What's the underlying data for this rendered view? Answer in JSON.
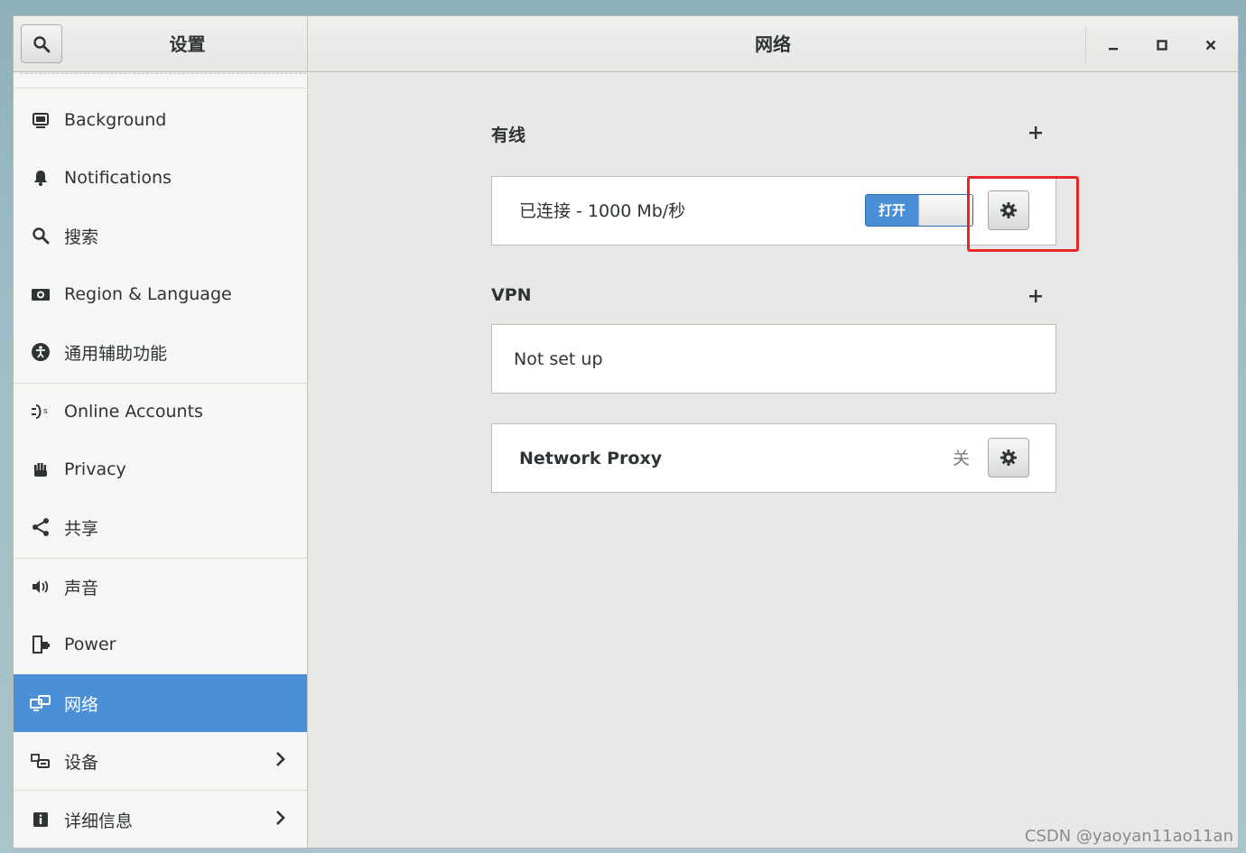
{
  "header": {
    "left_title": "设置",
    "title": "网络"
  },
  "window_controls": {
    "minimize": "minimize-icon",
    "maximize": "maximize-icon",
    "close": "close-icon"
  },
  "sidebar": {
    "items": [
      {
        "label": "Background",
        "icon": "background-icon"
      },
      {
        "label": "Notifications",
        "icon": "bell-icon"
      },
      {
        "label": "搜索",
        "icon": "search-icon"
      },
      {
        "label": "Region & Language",
        "icon": "camera-icon"
      },
      {
        "label": "通用辅助功能",
        "icon": "accessibility-icon"
      },
      {
        "label": "Online Accounts",
        "icon": "online-accounts-icon"
      },
      {
        "label": "Privacy",
        "icon": "hand-icon"
      },
      {
        "label": "共享",
        "icon": "share-icon"
      },
      {
        "label": "声音",
        "icon": "speaker-icon"
      },
      {
        "label": "Power",
        "icon": "power-icon"
      },
      {
        "label": "网络",
        "icon": "network-icon",
        "active": true
      },
      {
        "label": "设备",
        "icon": "devices-icon",
        "chevron": true
      },
      {
        "label": "详细信息",
        "icon": "info-icon",
        "chevron": true
      }
    ]
  },
  "wired": {
    "label": "有线",
    "status": "已连接 - 1000 Mb/秒",
    "switch_label": "打开"
  },
  "vpn": {
    "label": "VPN",
    "status": "Not set up"
  },
  "proxy": {
    "label": "Network Proxy",
    "state": "关"
  },
  "colors": {
    "accent": "#4a90d9",
    "highlight_box": "#e8262a"
  },
  "watermark": "CSDN @yaoyan11ao11an"
}
